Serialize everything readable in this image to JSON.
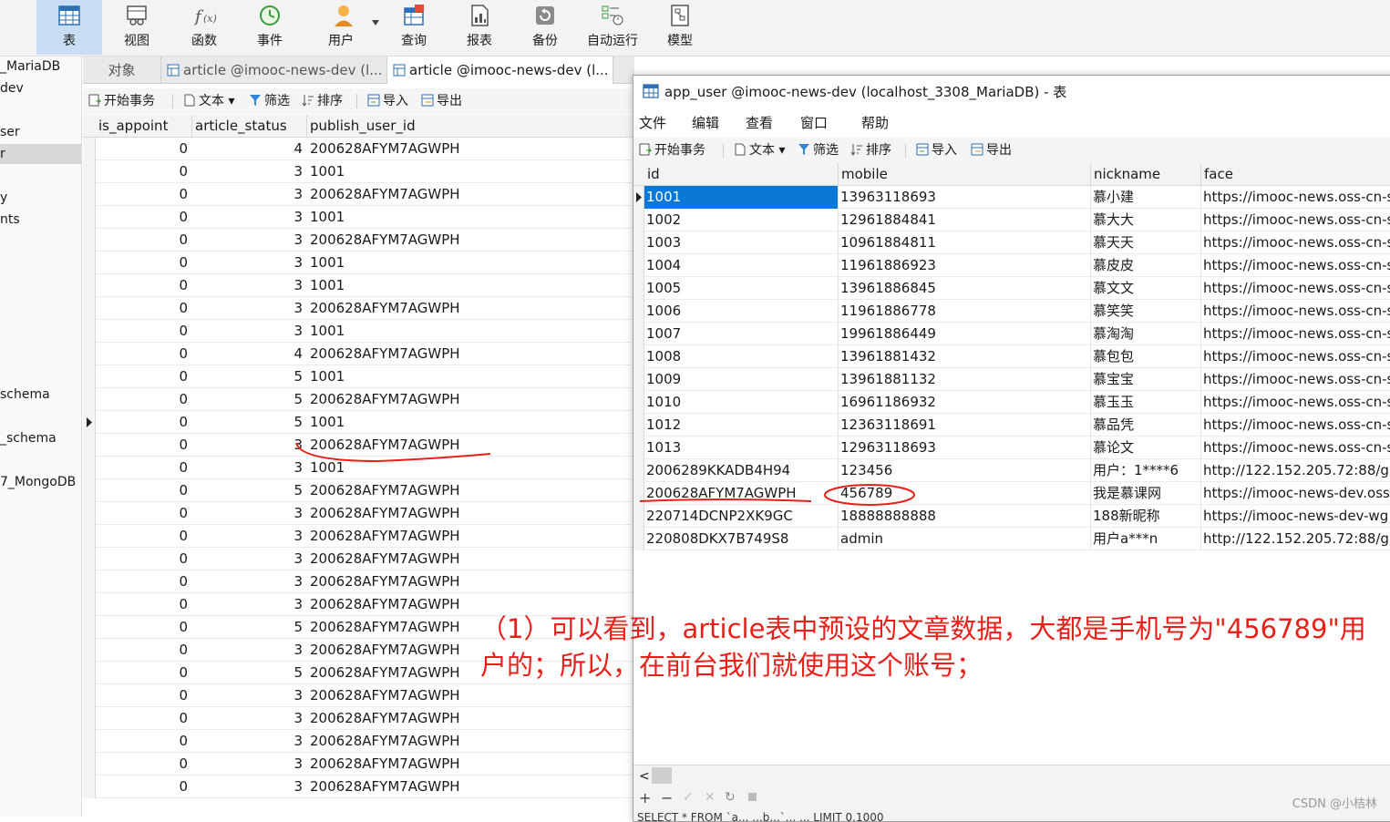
{
  "toolbar": {
    "items": [
      {
        "label": "表",
        "icon": "table-icon"
      },
      {
        "label": "视图",
        "icon": "view-icon"
      },
      {
        "label": "函数",
        "icon": "function-icon"
      },
      {
        "label": "事件",
        "icon": "event-clock-icon"
      },
      {
        "label": "用户",
        "icon": "user-icon"
      },
      {
        "label": "查询",
        "icon": "query-icon"
      },
      {
        "label": "报表",
        "icon": "report-icon"
      },
      {
        "label": "备份",
        "icon": "backup-icon"
      },
      {
        "label": "自动运行",
        "icon": "automation-icon"
      },
      {
        "label": "模型",
        "icon": "model-icon"
      }
    ],
    "active_index": 0,
    "accent": "#c7def5"
  },
  "sidebar": {
    "items": [
      "_MariaDB",
      "dev",
      "ser",
      "r",
      "y",
      "nts",
      "schema",
      "_schema",
      "7_MongoDB"
    ]
  },
  "tabs": [
    {
      "label": "对象"
    },
    {
      "label": "article @imooc-news-dev (l..."
    },
    {
      "label": "article @imooc-news-dev (l..."
    }
  ],
  "subtoolbar": {
    "begin_transaction": "开始事务",
    "text": "文本",
    "filter": "筛选",
    "sort": "排序",
    "import": "导入",
    "export": "导出"
  },
  "left_table": {
    "columns": [
      "is_appoint",
      "article_status",
      "publish_user_id"
    ],
    "rows": [
      [
        "0",
        "4",
        "200628AFYM7AGWPH"
      ],
      [
        "0",
        "3",
        "1001"
      ],
      [
        "0",
        "3",
        "200628AFYM7AGWPH"
      ],
      [
        "0",
        "3",
        "1001"
      ],
      [
        "0",
        "3",
        "200628AFYM7AGWPH"
      ],
      [
        "0",
        "3",
        "1001"
      ],
      [
        "0",
        "3",
        "1001"
      ],
      [
        "0",
        "3",
        "200628AFYM7AGWPH"
      ],
      [
        "0",
        "3",
        "1001"
      ],
      [
        "0",
        "4",
        "200628AFYM7AGWPH"
      ],
      [
        "0",
        "5",
        "1001"
      ],
      [
        "0",
        "5",
        "200628AFYM7AGWPH"
      ],
      [
        "0",
        "5",
        "1001"
      ],
      [
        "0",
        "3",
        "200628AFYM7AGWPH"
      ],
      [
        "0",
        "3",
        "1001"
      ],
      [
        "0",
        "5",
        "200628AFYM7AGWPH"
      ],
      [
        "0",
        "3",
        "200628AFYM7AGWPH"
      ],
      [
        "0",
        "3",
        "200628AFYM7AGWPH"
      ],
      [
        "0",
        "3",
        "200628AFYM7AGWPH"
      ],
      [
        "0",
        "3",
        "200628AFYM7AGWPH"
      ],
      [
        "0",
        "3",
        "200628AFYM7AGWPH"
      ],
      [
        "0",
        "5",
        "200628AFYM7AGWPH"
      ],
      [
        "0",
        "3",
        "200628AFYM7AGWPH"
      ],
      [
        "0",
        "5",
        "200628AFYM7AGWPH"
      ],
      [
        "0",
        "3",
        "200628AFYM7AGWPH"
      ],
      [
        "0",
        "3",
        "200628AFYM7AGWPH"
      ],
      [
        "0",
        "3",
        "200628AFYM7AGWPH"
      ],
      [
        "0",
        "3",
        "200628AFYM7AGWPH"
      ],
      [
        "0",
        "3",
        "200628AFYM7AGWPH"
      ]
    ],
    "current_row_index": 12
  },
  "window": {
    "title": "app_user @imooc-news-dev (localhost_3308_MariaDB) - 表",
    "menu": [
      "文件",
      "编辑",
      "查看",
      "窗口",
      "帮助"
    ],
    "selection_color": "#0b78d7"
  },
  "right_table": {
    "columns": [
      "id",
      "mobile",
      "nickname",
      "face"
    ],
    "rows": [
      [
        "1001",
        "13963118693",
        "慕小建",
        "https://imooc-news.oss-cn-s"
      ],
      [
        "1002",
        "12961884841",
        "慕大大",
        "https://imooc-news.oss-cn-s"
      ],
      [
        "1003",
        "10961884811",
        "慕天天",
        "https://imooc-news.oss-cn-s"
      ],
      [
        "1004",
        "11961886923",
        "慕皮皮",
        "https://imooc-news.oss-cn-s"
      ],
      [
        "1005",
        "13961886845",
        "慕文文",
        "https://imooc-news.oss-cn-s"
      ],
      [
        "1006",
        "11961886778",
        "慕笑笑",
        "https://imooc-news.oss-cn-s"
      ],
      [
        "1007",
        "19961886449",
        "慕淘淘",
        "https://imooc-news.oss-cn-s"
      ],
      [
        "1008",
        "13961881432",
        "慕包包",
        "https://imooc-news.oss-cn-s"
      ],
      [
        "1009",
        "13961881132",
        "慕宝宝",
        "https://imooc-news.oss-cn-s"
      ],
      [
        "1010",
        "16961186932",
        "慕玉玉",
        "https://imooc-news.oss-cn-s"
      ],
      [
        "1012",
        "12363118691",
        "慕品凭",
        "https://imooc-news.oss-cn-s"
      ],
      [
        "1013",
        "12963118693",
        "慕论文",
        "https://imooc-news.oss-cn-s"
      ],
      [
        "2006289KKADB4H94",
        "123456",
        "用户：1****6",
        "http://122.152.205.72:88/gr"
      ],
      [
        "200628AFYM7AGWPH",
        "456789",
        "我是慕课网",
        "https://imooc-news-dev.oss"
      ],
      [
        "220714DCNP2XK9GC",
        "18888888888",
        "188新昵称",
        "https://imooc-news-dev-wg"
      ],
      [
        "220808DKX7B749S8",
        "admin",
        "用户a***n",
        "http://122.152.205.72:88/gr"
      ]
    ],
    "selected_row_index": 0
  },
  "bottom_bar": {
    "sql_preview": "SELECT * FROM `a...         ...b...`...         ... LIMIT 0,1000"
  },
  "annotation": {
    "text": "（1）可以看到，article表中预设的文章数据，大都是手机号为\"456789\"用户的；所以，在前台我们就使用这个账号；",
    "color": "#e8201a"
  },
  "watermark": "CSDN @小桔林"
}
